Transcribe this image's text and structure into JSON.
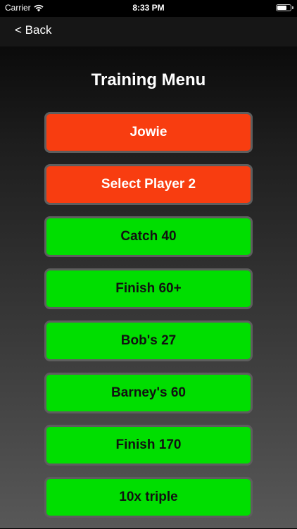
{
  "status_bar": {
    "carrier": "Carrier",
    "time": "8:33 PM"
  },
  "nav": {
    "back_label": "< Back"
  },
  "page": {
    "title": "Training Menu"
  },
  "colors": {
    "player_button": "#f83d10",
    "game_button": "#00de00"
  },
  "menu": {
    "items": [
      {
        "label": "Jowie",
        "color": "orange"
      },
      {
        "label": "Select Player 2",
        "color": "orange"
      },
      {
        "label": "Catch 40",
        "color": "green"
      },
      {
        "label": "Finish 60+",
        "color": "green"
      },
      {
        "label": "Bob's 27",
        "color": "green"
      },
      {
        "label": "Barney's 60",
        "color": "green"
      },
      {
        "label": "Finish 170",
        "color": "green"
      },
      {
        "label": "10x triple",
        "color": "green"
      }
    ]
  }
}
